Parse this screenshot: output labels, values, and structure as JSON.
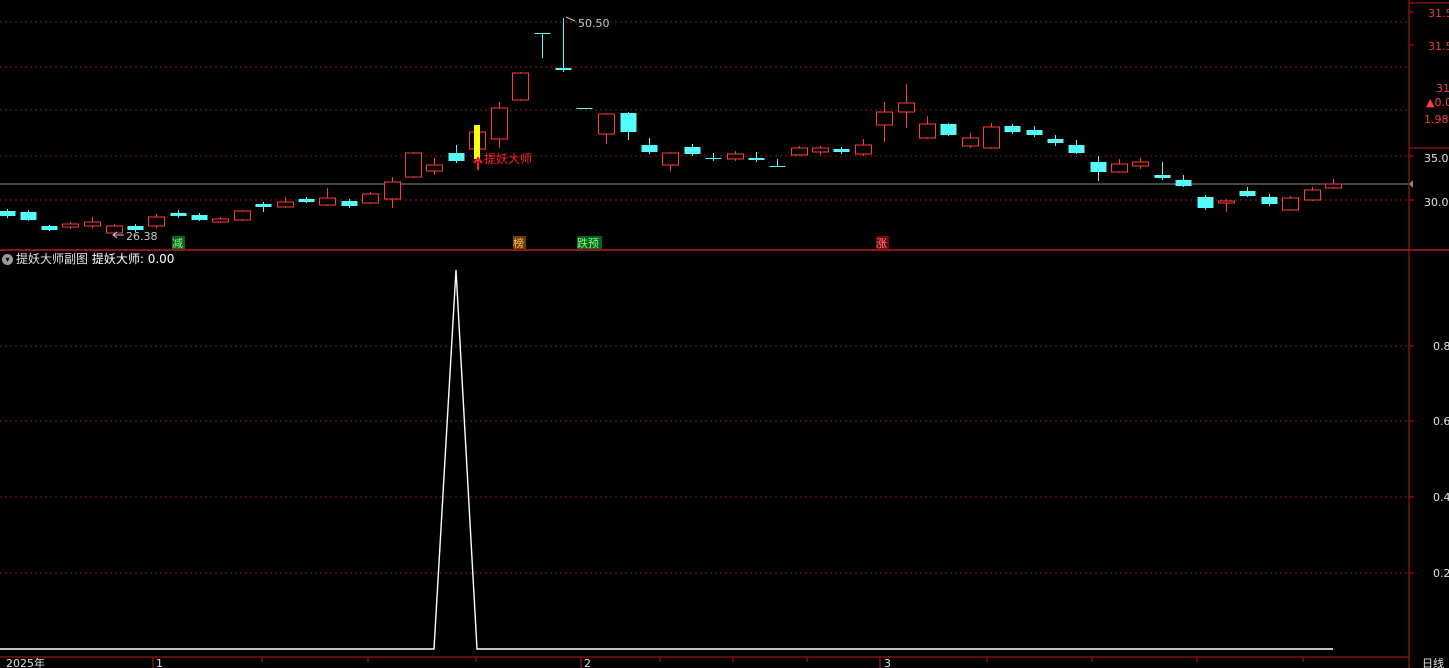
{
  "indicator_panel": {
    "title": "提妖大师副图",
    "value_label": "提妖大师: 0.00",
    "menu_icon": "chevron-down-icon"
  },
  "main_axis": {
    "ticks": [
      "31.5",
      "31.5",
      "31.0",
      "▲0.0",
      "1.98",
      "35.0",
      "30.0"
    ]
  },
  "sub_axis": {
    "ticks": [
      "0.8",
      "0.6",
      "0.4",
      "0.2"
    ]
  },
  "time_axis": {
    "labels": [
      "2025年",
      "1",
      "2",
      "3"
    ],
    "period_label": "日线"
  },
  "annotations": {
    "high_price": "50.50",
    "low_price": "26.38",
    "signal_text": "提妖大师",
    "badges": [
      "减",
      "榜",
      "跌预",
      "涨"
    ]
  },
  "colors": {
    "up": "#ff3b3b",
    "down": "#54fcfc",
    "signal": "#ffff00",
    "grid": "#8b1a1a",
    "line": "#ffffff"
  },
  "chart_data": {
    "type": "line",
    "series": [
      {
        "name": "提妖大师",
        "values": [
          0,
          0,
          0,
          0,
          0,
          0,
          0,
          0,
          0,
          0,
          0,
          0,
          0,
          0,
          0,
          0,
          0,
          0,
          0,
          0,
          0,
          1,
          0,
          0,
          0,
          0,
          0,
          0,
          0,
          0,
          0,
          0,
          0,
          0,
          0,
          0,
          0,
          0,
          0,
          0,
          0,
          0,
          0,
          0,
          0,
          0,
          0,
          0,
          0,
          0,
          0,
          0,
          0,
          0,
          0,
          0,
          0,
          0,
          0,
          0,
          0,
          0,
          0
        ]
      }
    ],
    "ylim": [
      0,
      1
    ],
    "yticks": [
      0.2,
      0.4,
      0.6,
      0.8
    ]
  }
}
